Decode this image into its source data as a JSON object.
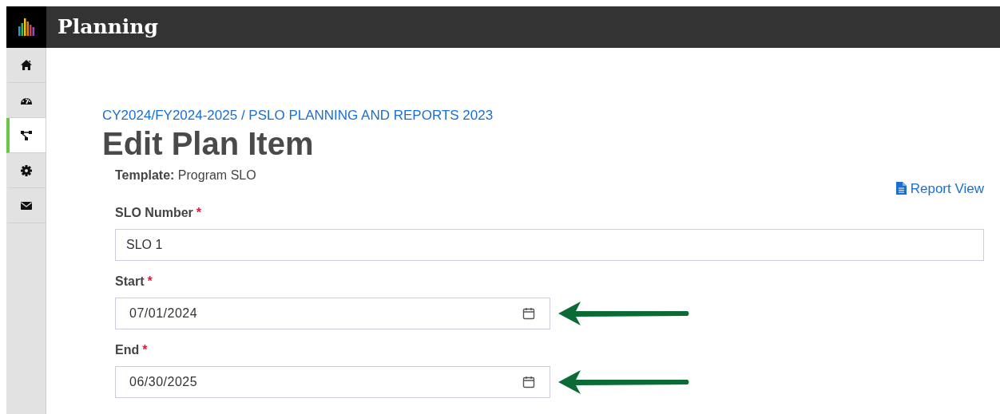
{
  "app": {
    "title": "Planning"
  },
  "sidebar": {
    "items": [
      {
        "selected": false
      },
      {
        "selected": false
      },
      {
        "selected": true
      },
      {
        "selected": false
      },
      {
        "selected": false
      }
    ]
  },
  "breadcrumb": "CY2024/FY2024-2025 / PSLO PLANNING AND REPORTS 2023",
  "heading": "Edit Plan Item",
  "template": {
    "label": "Template:",
    "value": "Program SLO"
  },
  "report_link": "Report View",
  "fields": [
    {
      "kind": "text",
      "label": "SLO Number",
      "required_mark": "*",
      "value": "SLO 1"
    },
    {
      "kind": "date",
      "label": "Start",
      "required_mark": "*",
      "value": "07/01/2024",
      "annotated": true
    },
    {
      "kind": "date",
      "label": "End",
      "required_mark": "*",
      "value": "06/30/2025",
      "annotated": true
    }
  ]
}
